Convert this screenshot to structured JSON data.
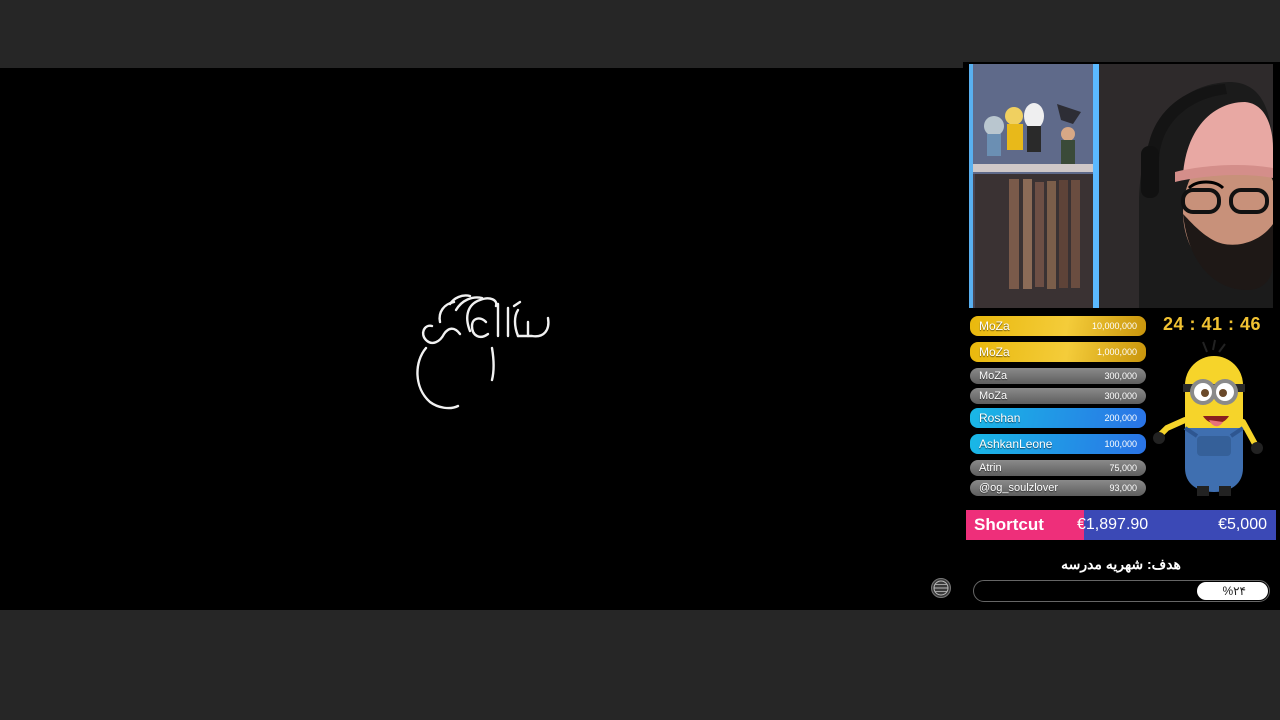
{
  "donations": [
    {
      "name": "MoZa",
      "amount": "10,000,000",
      "tier": "gold"
    },
    {
      "name": "MoZa",
      "amount": "1,000,000",
      "tier": "gold"
    },
    {
      "name": "MoZa",
      "amount": "300,000",
      "tier": "gray"
    },
    {
      "name": "MoZa",
      "amount": "300,000",
      "tier": "gray"
    },
    {
      "name": "Roshan",
      "amount": "200,000",
      "tier": "blue"
    },
    {
      "name": "AshkanLeone",
      "amount": "100,000",
      "tier": "blue"
    },
    {
      "name": "Atrin",
      "amount": "75,000",
      "tier": "gray"
    },
    {
      "name": "@og_soulzlover",
      "amount": "93,000",
      "tier": "gray"
    }
  ],
  "timer": "24 : 41 : 46",
  "shortcut_goal": {
    "name": "Shortcut",
    "raised": "€1,897.90",
    "target": "€5,000",
    "progress_fraction": 0.38,
    "fill_color": "#ee2f7a",
    "track_color": "#3b49b6"
  },
  "school_goal": {
    "title": "هدف: شهریه مدرسه",
    "percent_label": "%۲۴",
    "progress_fraction": 0.24
  },
  "colors": {
    "gold": "#f1c232",
    "blue": "#2a73e6",
    "gray": "#7a7a7a"
  },
  "icons": {
    "video_badge": "globe-icon",
    "mascot": "minion-icon"
  }
}
